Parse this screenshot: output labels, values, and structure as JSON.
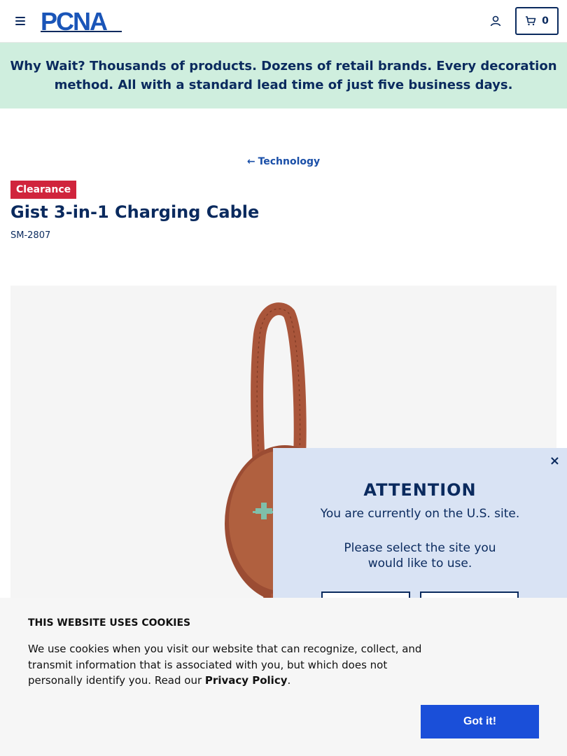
{
  "header": {
    "logo_text": "PCNA",
    "cart_count": "0",
    "icons": {
      "menu": "hamburger-menu-icon",
      "account": "user-icon",
      "cart": "cart-icon"
    }
  },
  "promo": {
    "lead": "Why Wait?",
    "text": "Thousands of products. Dozens of retail brands. Every decoration method. All with a standard lead time of just five business days."
  },
  "breadcrumb": {
    "label": "Technology"
  },
  "product": {
    "badge": "Clearance",
    "title": "Gist 3-in-1 Charging Cable",
    "sku": "SM-2807",
    "image_alt": "Gist 3-in-1 Charging Cable in brown"
  },
  "site_modal": {
    "close": "×",
    "title": "ATTENTION",
    "current": "You are currently on the U.S. site.",
    "select": "Please select the site you would like to use."
  },
  "cookie_banner": {
    "title": "THIS WEBSITE USES COOKIES",
    "text": "We use cookies when you visit our website that can recognize, collect, and transmit information that is associated with you, but which does not personally identify you. Read our",
    "link": "Privacy Policy",
    "end": ".",
    "button": "Got it!"
  },
  "colors": {
    "brand_navy": "#0a2a5e",
    "promo_bg": "#cfeede",
    "badge_red": "#d0243c",
    "modal_bg": "#d9e3f4",
    "cookie_button": "#1a4fd9",
    "product_brown": "#a9553a"
  }
}
